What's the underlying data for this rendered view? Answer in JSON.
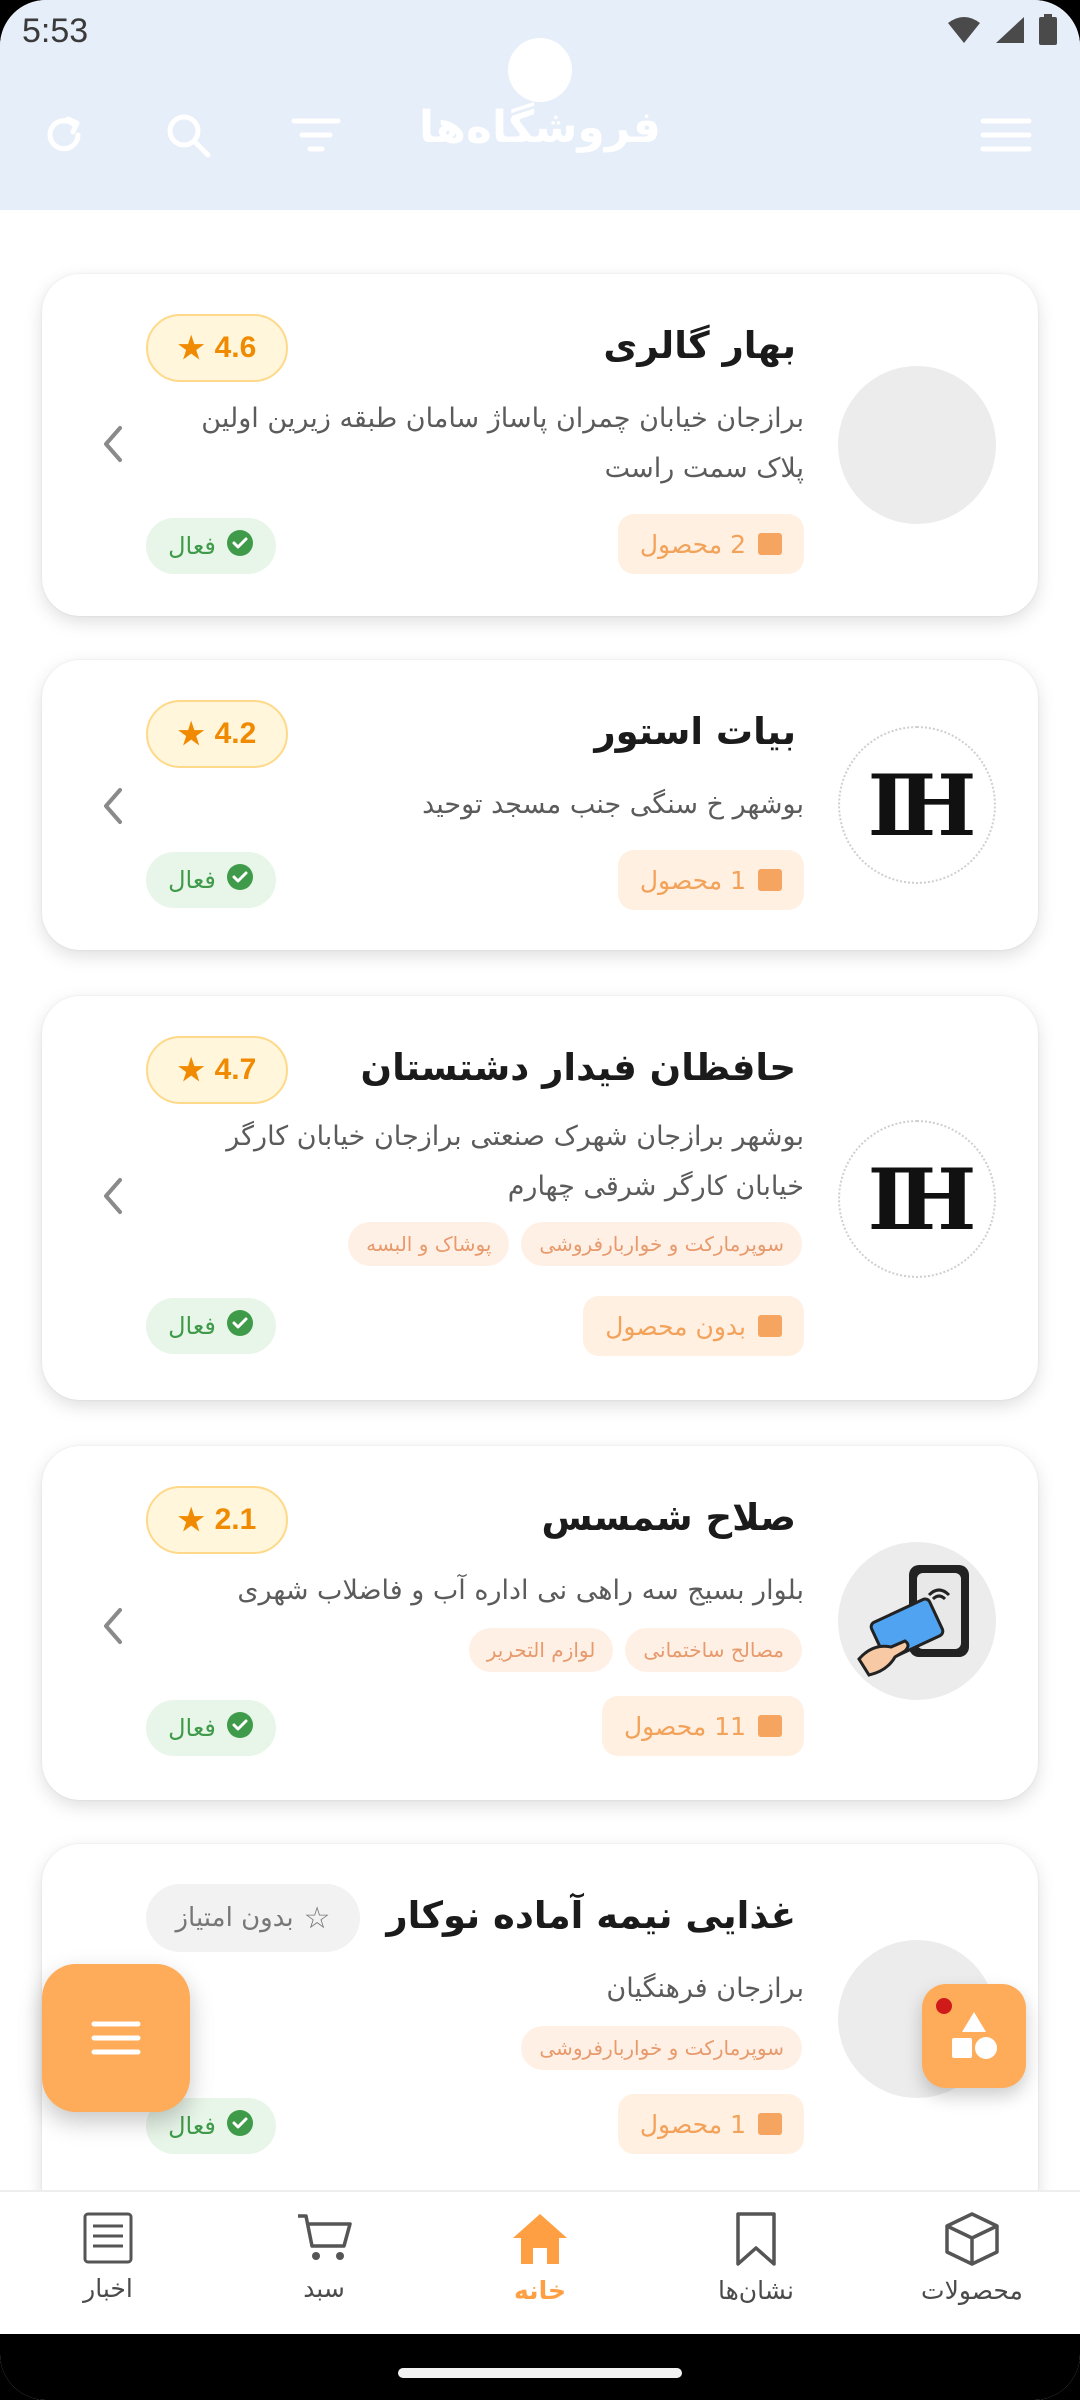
{
  "status_bar": {
    "time": "5:53"
  },
  "app_bar": {
    "title": "فروشگاه‌ها"
  },
  "stores": [
    {
      "name": "بهار گالری",
      "rating": "4.6",
      "address_lines": [
        "برازجان خیابان چمران پاساژ سامان طبقه زیرین اولین",
        "پلاک سمت راست"
      ],
      "tags": [],
      "products": "2 محصول",
      "status": "فعال"
    },
    {
      "name": "بیات استور",
      "rating": "4.2",
      "address_lines": [
        "بوشهر خ سنگی جنب مسجد توحید"
      ],
      "tags": [],
      "products": "1 محصول",
      "status": "فعال"
    },
    {
      "name": "حافظان فیدار دشتستان",
      "rating": "4.7",
      "address_lines": [
        "بوشهر برازجان شهرک صنعتی برازجان خیابان کارگر",
        "خیابان کارگر شرقی چهارم"
      ],
      "tags": [
        "سوپرمارکت و خواربارفروشی",
        "پوشاک و البسه"
      ],
      "products": "بدون محصول",
      "status": "فعال"
    },
    {
      "name": "صلاح شمسس",
      "rating": "2.1",
      "address_lines": [
        "بلوار بسیج سه راهی نی اداره آب و فاضلاب شهری"
      ],
      "tags": [
        "مصالح ساختمانی",
        "لوازم التحریر"
      ],
      "products": "11 محصول",
      "status": "فعال"
    },
    {
      "name": "غذایی نیمه آماده نوکار",
      "rating": "بدون امتیاز",
      "address_lines": [
        "برازجان فرهنگیان"
      ],
      "tags": [
        "سوپرمارکت و خواربارفروشی"
      ],
      "products": "1 محصول",
      "status": "فعال"
    }
  ],
  "logo_text": "IH",
  "bottom_nav": [
    {
      "label": "اخبار",
      "icon": "news-icon"
    },
    {
      "label": "سبد",
      "icon": "cart-icon"
    },
    {
      "label": "خانه",
      "icon": "home-icon",
      "selected": true
    },
    {
      "label": "نشان‌ها",
      "icon": "bookmark-icon"
    },
    {
      "label": "محصولات",
      "icon": "box-icon"
    }
  ],
  "colors": {
    "accent": "#ffac5a",
    "header_bg": "#e6eef9",
    "rating_text": "#f08a00",
    "active_green": "#3f9b4a"
  }
}
